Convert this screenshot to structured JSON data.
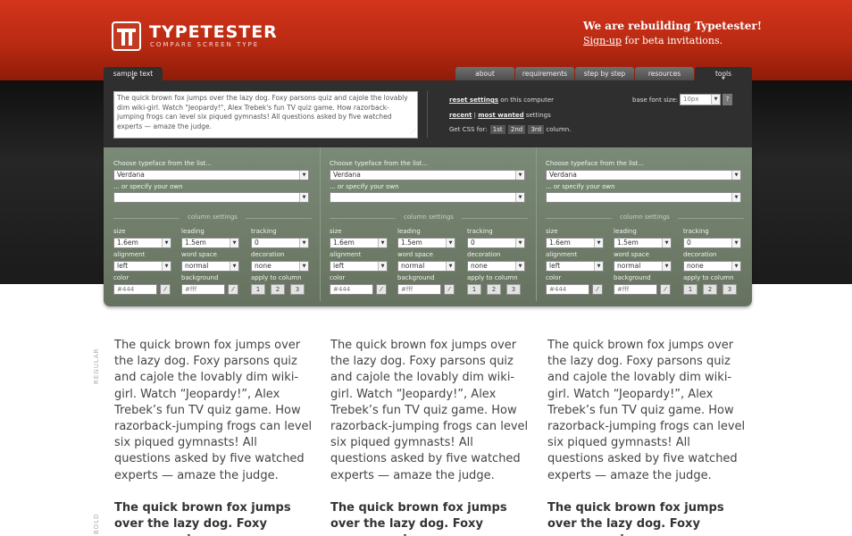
{
  "header": {
    "logo_mark": "TT",
    "title": "TYPETESTER",
    "subtitle": "COMPARE SCREEN TYPE",
    "announce_head": "We are rebuilding Typetester!",
    "signup_link": "Sign-up",
    "announce_tail": " for beta invitations."
  },
  "tabs": {
    "sample": "sample text",
    "about": "about",
    "requirements": "requirements",
    "step": "step by step",
    "resources": "resources",
    "tools": "tools"
  },
  "panel": {
    "sample_text": "The quick brown fox jumps over the lazy dog. Foxy parsons quiz and cajole the lovably dim wiki-girl. Watch \"Jeopardy!\", Alex Trebek's fun TV quiz game. How razorback-jumping frogs can level six piqued gymnasts! All questions asked by five watched experts — amaze the judge.",
    "reset_link": "reset settings",
    "reset_tail": " on this computer",
    "recent_link": "recent",
    "sep": " | ",
    "most_wanted_link": "most wanted",
    "settings_tail": " settings",
    "css_label": "Get CSS for:",
    "css_1": "1st",
    "css_2": "2nd",
    "css_3": "3rd",
    "css_tail": "column.",
    "base_font_label": "base font size:",
    "base_font_value": "10px",
    "help": "?"
  },
  "columns": [
    {
      "choose_label": "Choose typeface from the list...",
      "typeface": "Verdana",
      "own_label": "... or specify your own",
      "own_value": "",
      "settings_label": "column settings",
      "size_label": "size",
      "size": "1.6em",
      "leading_label": "leading",
      "leading": "1.5em",
      "tracking_label": "tracking",
      "tracking": "0",
      "alignment_label": "alignment",
      "alignment": "left",
      "wordspace_label": "word space",
      "wordspace": "normal",
      "decoration_label": "decoration",
      "decoration": "none",
      "color_label": "color",
      "color": "#444",
      "background_label": "background",
      "background": "#fff",
      "apply_label": "apply to column",
      "apply_1": "1",
      "apply_2": "2",
      "apply_3": "3"
    },
    {
      "choose_label": "Choose typeface from the list...",
      "typeface": "Verdana",
      "own_label": "... or specify your own",
      "own_value": "",
      "settings_label": "column settings",
      "size_label": "size",
      "size": "1.6em",
      "leading_label": "leading",
      "leading": "1.5em",
      "tracking_label": "tracking",
      "tracking": "0",
      "alignment_label": "alignment",
      "alignment": "left",
      "wordspace_label": "word space",
      "wordspace": "normal",
      "decoration_label": "decoration",
      "decoration": "none",
      "color_label": "color",
      "color": "#444",
      "background_label": "background",
      "background": "#fff",
      "apply_label": "apply to column",
      "apply_1": "1",
      "apply_2": "2",
      "apply_3": "3"
    },
    {
      "choose_label": "Choose typeface from the list...",
      "typeface": "Verdana",
      "own_label": "... or specify your own",
      "own_value": "",
      "settings_label": "column settings",
      "size_label": "size",
      "size": "1.6em",
      "leading_label": "leading",
      "leading": "1.5em",
      "tracking_label": "tracking",
      "tracking": "0",
      "alignment_label": "alignment",
      "alignment": "left",
      "wordspace_label": "word space",
      "wordspace": "normal",
      "decoration_label": "decoration",
      "decoration": "none",
      "color_label": "color",
      "color": "#444",
      "background_label": "background",
      "background": "#fff",
      "apply_label": "apply to column",
      "apply_1": "1",
      "apply_2": "2",
      "apply_3": "3"
    }
  ],
  "preview": {
    "regular_label": "REGULAR",
    "bold_label": "BOLD",
    "regular_text": "The quick brown fox jumps over the lazy dog. Foxy parsons quiz and cajole the lovably dim wiki-girl. Watch “Jeopardy!”, Alex Trebek’s fun TV quiz game. How razorback-jumping frogs can level six piqued gymnasts! All questions asked by five watched experts — amaze the judge.",
    "bold_text": "The quick brown fox jumps over the lazy dog. Foxy parsons quiz"
  },
  "colors": {
    "header_red": "#b92a12",
    "panel_dark": "#2f2f2f",
    "settings_green": "#6f7d69",
    "text": "#444444"
  },
  "icons": {
    "logo": "tt-logo-icon",
    "dropdown": "chevron-down-icon",
    "picker": "eyedropper-icon",
    "grip": "resize-grip-icon"
  }
}
